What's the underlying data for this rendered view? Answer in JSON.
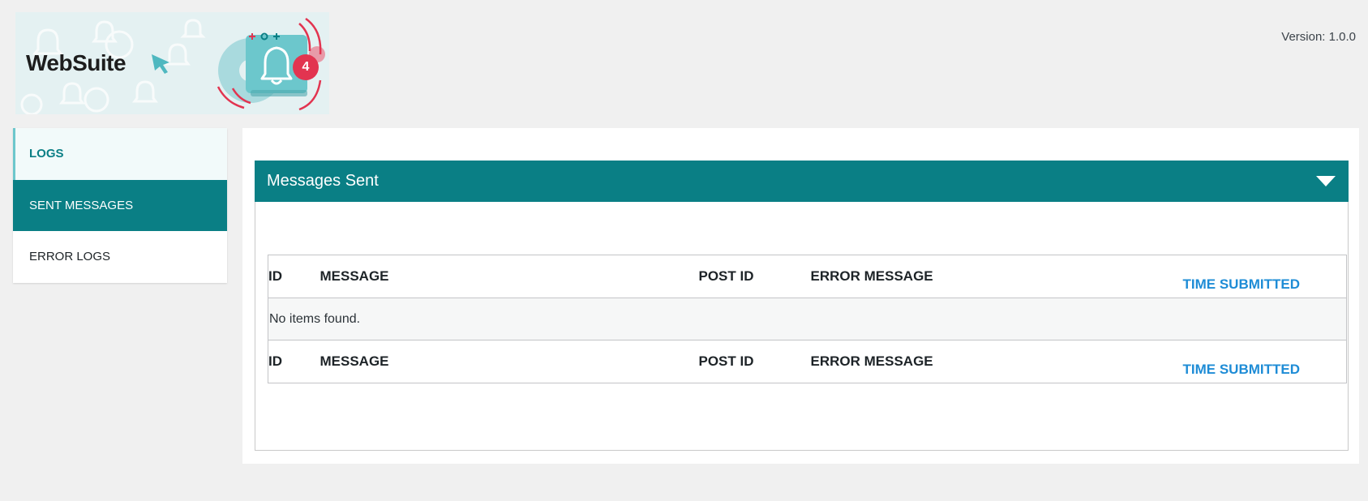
{
  "brand": {
    "name": "WebSuite",
    "notification_count": "4",
    "logo_icon": "bell-icon"
  },
  "version_text": "Version: 1.0.0",
  "sidebar": {
    "items": [
      {
        "label": "LOGS",
        "state": "heading"
      },
      {
        "label": "SENT MESSAGES",
        "state": "active"
      },
      {
        "label": "ERROR LOGS",
        "state": "normal"
      }
    ]
  },
  "panel": {
    "title": "Messages Sent",
    "toggle_icon": "caret-down-icon"
  },
  "table": {
    "columns": [
      "ID",
      "MESSAGE",
      "POST ID",
      "ERROR MESSAGE",
      "TIME SUBMITTED"
    ],
    "empty_text": "No items found."
  },
  "colors": {
    "accent": "#0a7f85",
    "link": "#1e8cd6",
    "badge": "#e23450",
    "background": "#f0f0f0"
  }
}
